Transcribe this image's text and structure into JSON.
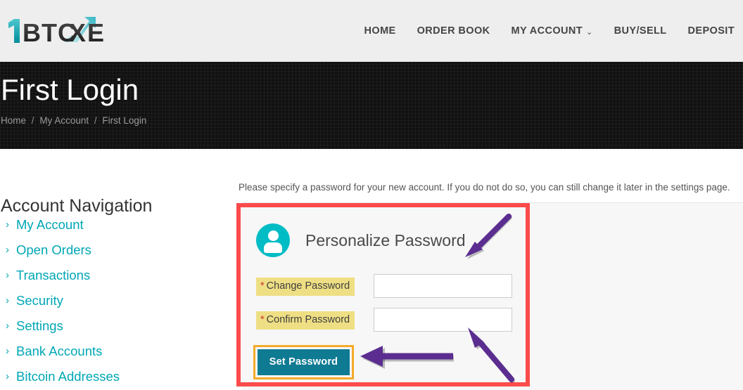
{
  "header": {
    "logo_text": "1BTCXE",
    "logo_icon": "bitcoin-exchange-logo",
    "nav": [
      {
        "label": "HOME",
        "name": "nav-home",
        "caret": false
      },
      {
        "label": "ORDER BOOK",
        "name": "nav-order-book",
        "caret": false
      },
      {
        "label": "MY ACCOUNT",
        "name": "nav-my-account",
        "caret": true,
        "caret_glyph": "⌄"
      },
      {
        "label": "BUY/SELL",
        "name": "nav-buy-sell",
        "caret": false
      },
      {
        "label": "DEPOSIT",
        "name": "nav-deposit",
        "caret": false
      }
    ]
  },
  "hero": {
    "title": "First Login",
    "breadcrumb": [
      {
        "label": "Home"
      },
      {
        "label": "My Account"
      },
      {
        "label": "First Login"
      }
    ],
    "breadcrumb_separator": "/"
  },
  "sidebar": {
    "title": "Account Navigation",
    "chevron_glyph": "›",
    "items": [
      {
        "label": "My Account",
        "name": "sidebar-item-my-account"
      },
      {
        "label": "Open Orders",
        "name": "sidebar-item-open-orders"
      },
      {
        "label": "Transactions",
        "name": "sidebar-item-transactions"
      },
      {
        "label": "Security",
        "name": "sidebar-item-security"
      },
      {
        "label": "Settings",
        "name": "sidebar-item-settings"
      },
      {
        "label": "Bank Accounts",
        "name": "sidebar-item-bank-accounts"
      },
      {
        "label": "Bitcoin Addresses",
        "name": "sidebar-item-bitcoin-addresses"
      }
    ]
  },
  "main": {
    "intro": "Please specify a password for your new account. If you do not do so, you can still change it later in the settings page.",
    "card": {
      "title": "Personalize Password",
      "avatar_icon": "user-avatar-icon",
      "fields": [
        {
          "required_marker": "*",
          "label": "Change Password",
          "value": "",
          "placeholder": "",
          "name": "change-password-input"
        },
        {
          "required_marker": "*",
          "label": "Confirm Password",
          "value": "",
          "placeholder": "",
          "name": "confirm-password-input"
        }
      ],
      "submit_label": "Set Password"
    }
  },
  "annotations": [
    {
      "name": "arrow-to-change-password-field",
      "direction": "down-left"
    },
    {
      "name": "arrow-to-confirm-password-field",
      "direction": "up-left"
    },
    {
      "name": "arrow-to-set-password-button",
      "direction": "left"
    }
  ],
  "colors": {
    "accent_teal": "#00a7b5",
    "avatar_teal": "#00bcc5",
    "button_teal": "#0f7b93",
    "highlight_red": "#fc4b4b",
    "highlight_orange": "#f3ab2b",
    "label_yellow": "#efdf84",
    "annotation_purple": "#5b2d90",
    "header_gray": "#eeeeee",
    "hero_dark": "#111111",
    "panel_gray": "#f7f7f7"
  }
}
